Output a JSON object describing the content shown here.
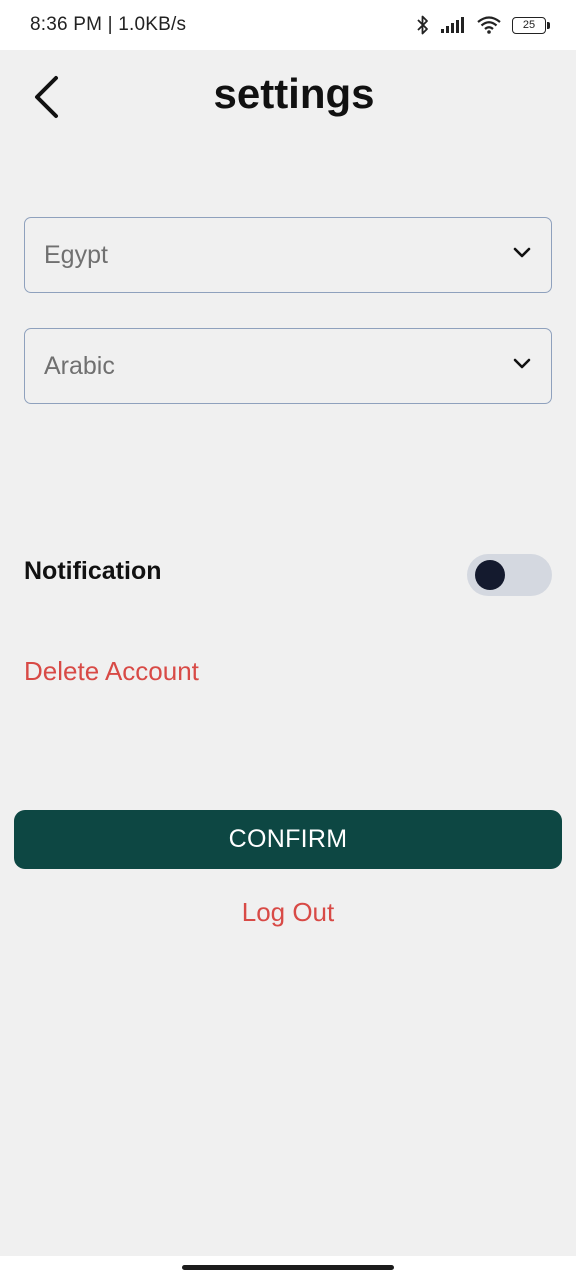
{
  "status_bar": {
    "time": "8:36 PM | 1.0KB/s",
    "battery": "25",
    "icons": [
      "bluetooth-icon",
      "signal-icon",
      "wifi-icon",
      "battery-icon"
    ]
  },
  "header": {
    "title": "settings",
    "back_icon": "chevron-left-icon"
  },
  "country_select": {
    "value": "Egypt",
    "icon": "chevron-down-icon"
  },
  "language_select": {
    "value": "Arabic",
    "icon": "chevron-down-icon"
  },
  "notification": {
    "label": "Notification",
    "enabled": false
  },
  "delete_account_label": "Delete Account",
  "confirm_label": "CONFIRM",
  "logout_label": "Log Out",
  "colors": {
    "primary": "#0d4743",
    "danger": "#d84a46",
    "background": "#f0f0f0",
    "toggle_track": "#d4d8e0",
    "toggle_knob": "#141a2e"
  }
}
